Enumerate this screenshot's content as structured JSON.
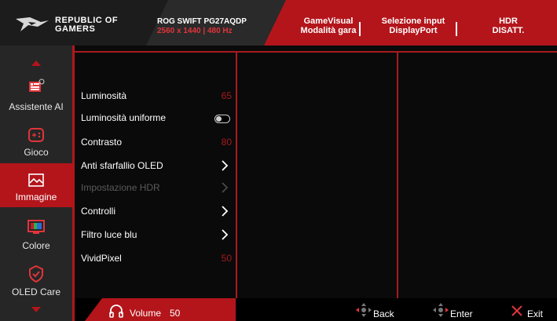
{
  "header": {
    "brand_line1": "REPUBLIC OF",
    "brand_line2": "GAMERS",
    "model_name": "ROG SWIFT PG27AQDP",
    "model_res": "2560 x 1440  | 480 Hz",
    "info": [
      {
        "line1": "GameVisual",
        "line2": "Modalità gara"
      },
      {
        "line1": "Selezione input",
        "line2": "DisplayPort"
      },
      {
        "line1": "HDR",
        "line2": "DISATT."
      }
    ]
  },
  "sidebar": {
    "items": [
      {
        "label": "Assistente AI",
        "icon": "ai-assistant-icon"
      },
      {
        "label": "Gioco",
        "icon": "gamepad-icon"
      },
      {
        "label": "Immagine",
        "icon": "image-icon"
      },
      {
        "label": "Colore",
        "icon": "color-icon"
      },
      {
        "label": "OLED Care",
        "icon": "shield-check-icon"
      }
    ]
  },
  "menu": {
    "items": [
      {
        "label": "Luminosità",
        "value": "65"
      },
      {
        "label": "Luminosità uniforme"
      },
      {
        "label": "Contrasto",
        "value": "80"
      },
      {
        "label": "Anti sfarfallio OLED"
      },
      {
        "label": "Impostazione HDR"
      },
      {
        "label": "Controlli"
      },
      {
        "label": "Filtro luce blu"
      },
      {
        "label": "VividPixel",
        "value": "50"
      }
    ]
  },
  "footer": {
    "volume_label": "Volume",
    "volume_value": "50",
    "back_label": "Back",
    "enter_label": "Enter",
    "exit_label": "Exit"
  },
  "colors": {
    "accent": "#b3151b",
    "value_red": "#a81a1f"
  }
}
